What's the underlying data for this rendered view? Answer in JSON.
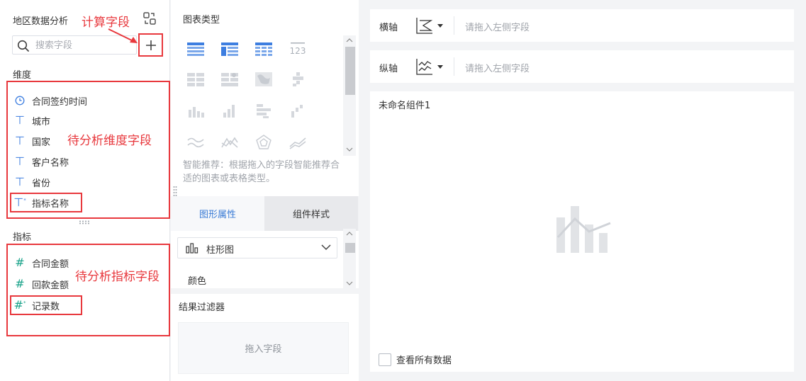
{
  "dataset": {
    "title": "地区数据分析"
  },
  "search": {
    "placeholder": "搜索字段"
  },
  "dimensions": {
    "label": "维度",
    "fields": [
      "合同签约时间",
      "城市",
      "国家",
      "客户名称",
      "省份",
      "指标名称"
    ]
  },
  "measures": {
    "label": "指标",
    "fields": [
      "合同金额",
      "回款金额",
      "记录数"
    ]
  },
  "annotations": {
    "calc_field": "计算字段",
    "dim_fields": "待分析维度字段",
    "measure_fields": "待分析指标字段"
  },
  "chart_types": {
    "title": "图表类型",
    "hint": "智能推荐：根据拖入的字段智能推荐合适的图表或表格类型。"
  },
  "tabs": {
    "graph_props": "图形属性",
    "component_style": "组件样式"
  },
  "chart_select": {
    "value": "柱形图"
  },
  "color_label": "颜色",
  "filter": {
    "title": "结果过滤器",
    "drop_placeholder": "拖入字段"
  },
  "axes": {
    "x_label": "横轴",
    "y_label": "纵轴",
    "x_placeholder": "请拖入左侧字段",
    "y_placeholder": "请拖入左侧字段"
  },
  "canvas": {
    "component_name": "未命名组件1",
    "view_all": "查看所有数据"
  },
  "colors": {
    "accent": "#3a7bd5",
    "annotation": "#e8383d",
    "measure_icon": "#1aa38a"
  }
}
